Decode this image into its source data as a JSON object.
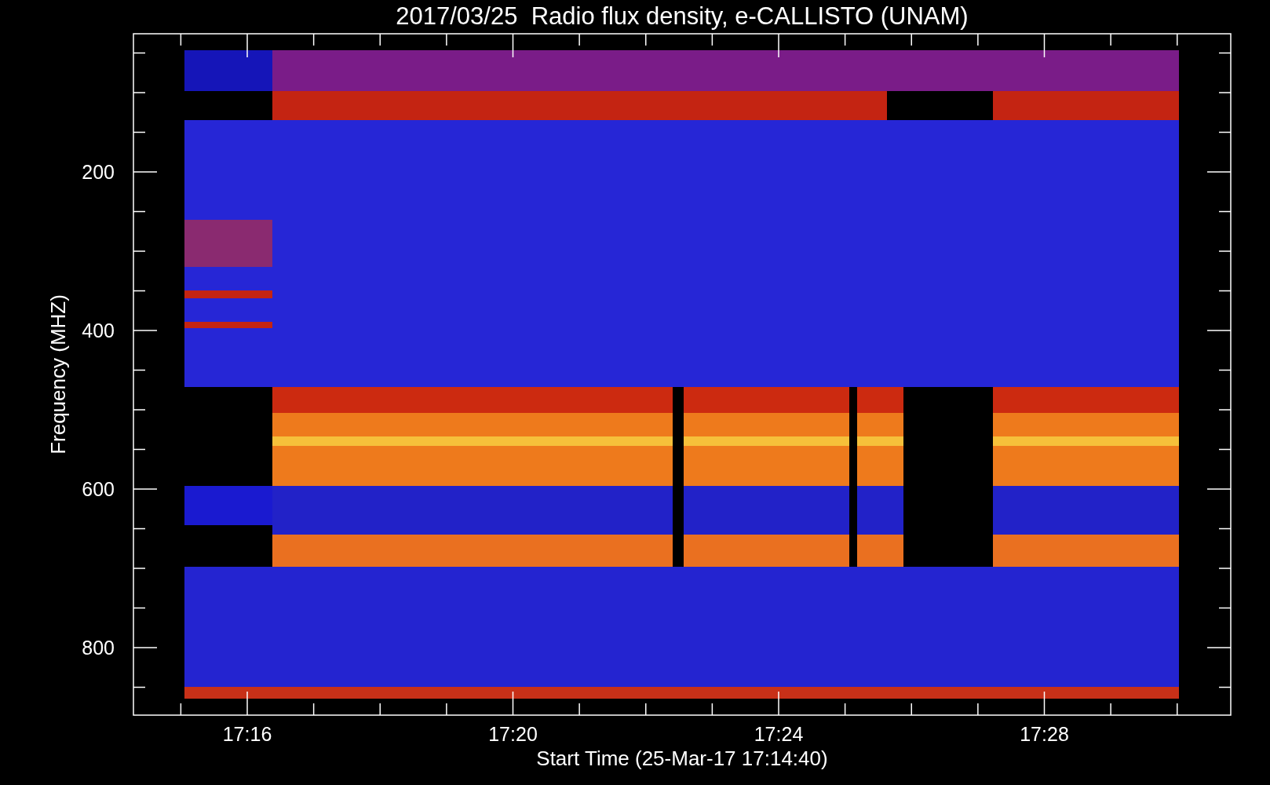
{
  "title": "2017/03/25  Radio flux density, e-CALLISTO (UNAM)",
  "plot": {
    "ylabel": "Frequency (MHZ)",
    "xlabel": "Start Time (25-Mar-17 17:14:40)",
    "yticks": [
      "200",
      "400",
      "600",
      "800"
    ],
    "xticks": [
      "17:16",
      "17:20",
      "17:24",
      "17:28"
    ]
  }
}
